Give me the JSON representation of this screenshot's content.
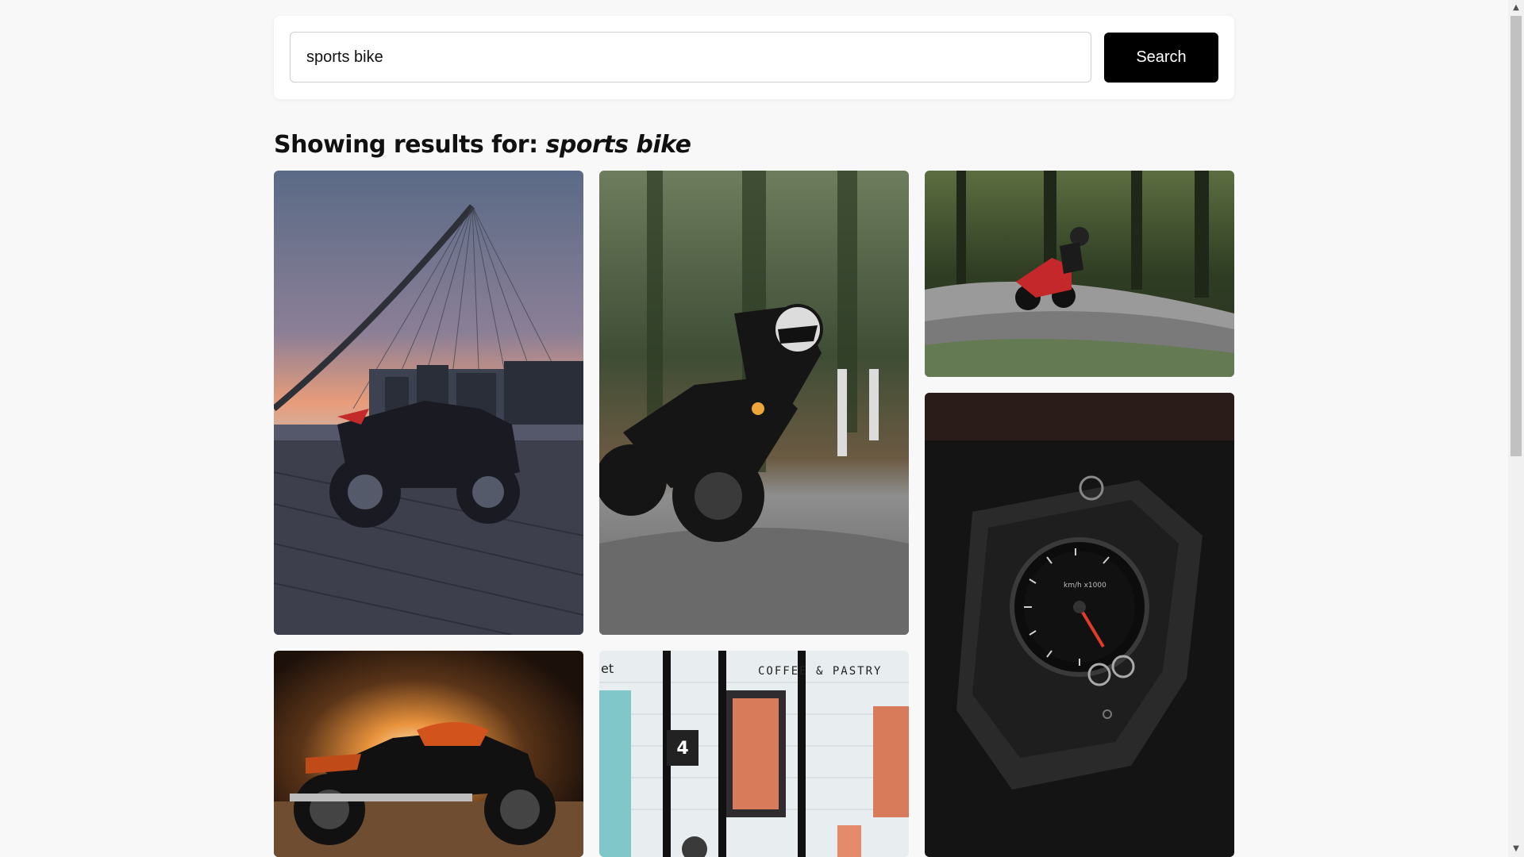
{
  "search": {
    "value": "sports bike",
    "button_label": "Search"
  },
  "results": {
    "prefix": "Showing results for:",
    "query": "sports bike"
  },
  "images": [
    {
      "name": "sportbike-under-harp-bridge"
    },
    {
      "name": "rider-leaning-in-forest-curve"
    },
    {
      "name": "red-sportbike-forest-road"
    },
    {
      "name": "speedometer-closeup"
    },
    {
      "name": "orange-cruiser-in-tunnel"
    },
    {
      "name": "cafe-storefront-with-bike"
    }
  ],
  "speedometer": {
    "label": "km/h x1000"
  },
  "storefront": {
    "sign": "COFFEE & PASTRY",
    "door_number": "4",
    "partial_text": "et"
  },
  "scrollbar": {
    "up_arrow": "▲",
    "down_arrow": "▼"
  }
}
